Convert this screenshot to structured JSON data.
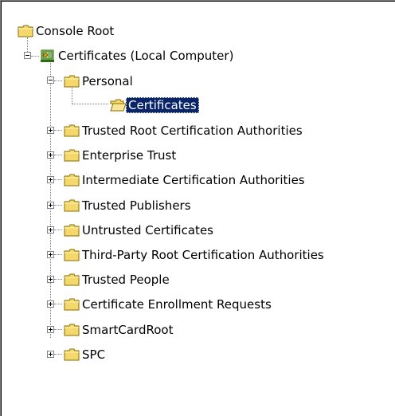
{
  "tree": {
    "root": {
      "label": "Console Root",
      "icon": "folder-icon"
    },
    "snapin": {
      "label": "Certificates (Local Computer)",
      "icon": "certificates-snapin-icon"
    },
    "personal": {
      "label": "Personal",
      "icon": "folder-open-icon"
    },
    "personal_certificates": {
      "label": "Certificates",
      "icon": "folder-open-icon",
      "selected": true
    },
    "stores": [
      {
        "label": "Trusted Root Certification Authorities"
      },
      {
        "label": "Enterprise Trust"
      },
      {
        "label": "Intermediate Certification Authorities"
      },
      {
        "label": "Trusted Publishers"
      },
      {
        "label": "Untrusted Certificates"
      },
      {
        "label": "Third-Party Root Certification Authorities"
      },
      {
        "label": "Trusted People"
      },
      {
        "label": "Certificate Enrollment Requests"
      },
      {
        "label": "SmartCardRoot"
      },
      {
        "label": "SPC"
      }
    ]
  },
  "colors": {
    "folder": "#f4d86b",
    "folder_outline": "#8a6d00",
    "selection": "#0a246a"
  }
}
